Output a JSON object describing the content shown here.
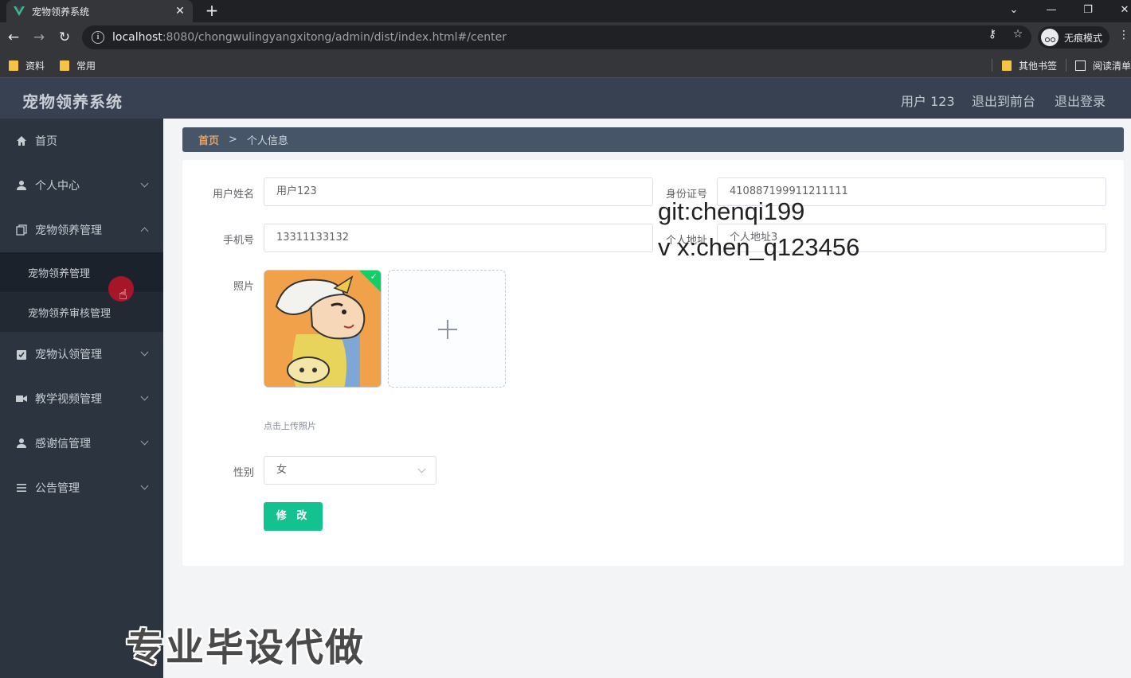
{
  "browser": {
    "tab_title": "宠物领养系统",
    "url_host": "localhost",
    "url_rest": ":8080/chongwulingyangxitong/admin/dist/index.html#/center",
    "incognito_label": "无痕模式",
    "bookmarks": [
      "资料",
      "常用"
    ],
    "bookmarks_right": [
      "其他书签",
      "阅读清单"
    ]
  },
  "header": {
    "brand": "宠物领养系统",
    "user": "用户 123",
    "to_front": "退出到前台",
    "logout": "退出登录"
  },
  "sidebar": {
    "items": [
      {
        "label": "首页",
        "icon": "home-icon"
      },
      {
        "label": "个人中心",
        "icon": "user-icon"
      },
      {
        "label": "宠物领养管理",
        "icon": "copy-icon",
        "expanded": true,
        "children": [
          "宠物领养管理",
          "宠物领养审核管理"
        ]
      },
      {
        "label": "宠物认领管理",
        "icon": "clipboard-check-icon"
      },
      {
        "label": "教学视频管理",
        "icon": "video-icon"
      },
      {
        "label": "感谢信管理",
        "icon": "user-icon"
      },
      {
        "label": "公告管理",
        "icon": "list-icon"
      }
    ]
  },
  "breadcrumb": {
    "home": "首页",
    "sep": ">",
    "current": "个人信息"
  },
  "form": {
    "name_label": "用户姓名",
    "name_value": "用户123",
    "id_label": "身份证号",
    "id_value": "410887199911211111",
    "phone_label": "手机号",
    "phone_value": "13311133132",
    "address_label": "个人地址",
    "address_value": "个人地址3",
    "photo_label": "照片",
    "upload_hint": "点击上传照片",
    "gender_label": "性别",
    "gender_value": "女",
    "submit_label": "修 改"
  },
  "watermarks": {
    "line1": "git:chenqi199",
    "line2": "v x:chen_q123456",
    "line3": "专业毕设代做"
  },
  "colors": {
    "header_bg": "#374151",
    "sidebar_bg": "#2c3440",
    "breadcrumb_bg": "#475569",
    "accent_green": "#13c28f",
    "breadcrumb_home": "#e0a36a"
  }
}
